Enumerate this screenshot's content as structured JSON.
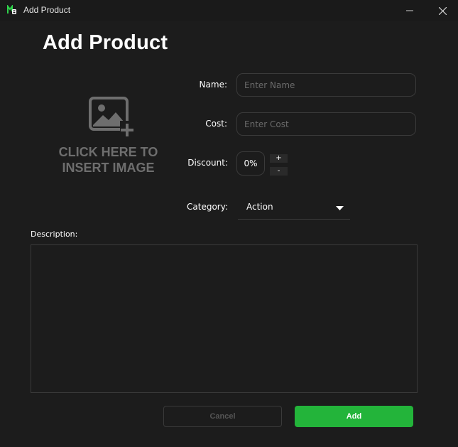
{
  "window": {
    "title": "Add Product",
    "logo_icon": "app-logo-icon",
    "controls": [
      "minimize-icon",
      "close-icon"
    ]
  },
  "page": {
    "heading": "Add Product"
  },
  "image_upload": {
    "icon": "add-image-icon",
    "line1": "CLICK HERE TO",
    "line2": "INSERT IMAGE"
  },
  "form": {
    "name": {
      "label": "Name:",
      "placeholder": "Enter Name",
      "value": ""
    },
    "cost": {
      "label": "Cost:",
      "placeholder": "Enter Cost",
      "value": ""
    },
    "discount": {
      "label": "Discount:",
      "value": "0%",
      "increment": "+",
      "decrement": "-"
    },
    "category": {
      "label": "Category:",
      "selected": "Action"
    },
    "description": {
      "label": "Description:",
      "value": ""
    }
  },
  "actions": {
    "cancel": "Cancel",
    "add": "Add"
  },
  "colors": {
    "background": "#1c1c1c",
    "accent": "#23b43a",
    "border": "#3a3a3a",
    "placeholder": "#6a6a6a"
  }
}
